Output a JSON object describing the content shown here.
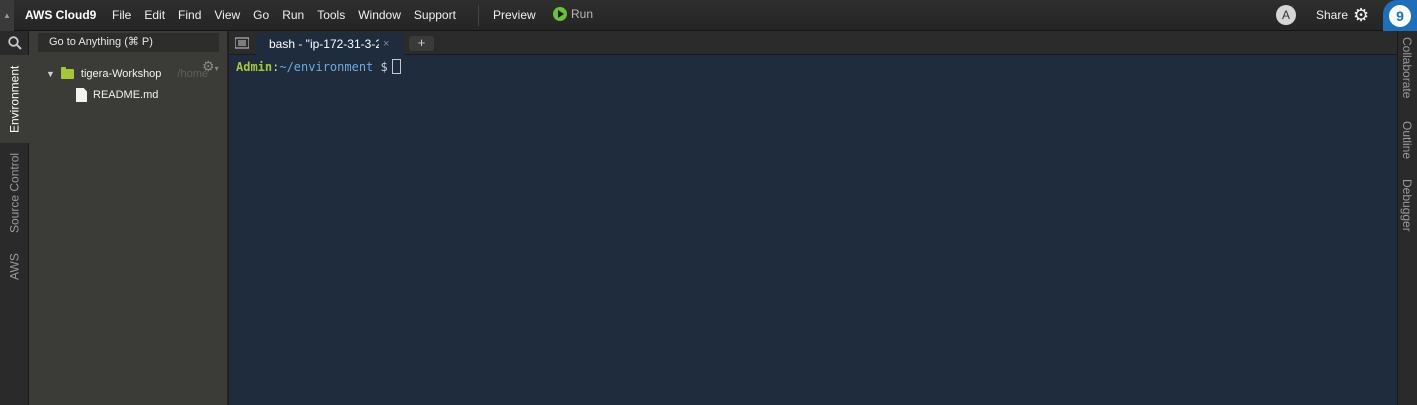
{
  "menubar": {
    "brand": "AWS Cloud9",
    "menus": [
      "File",
      "Edit",
      "Find",
      "View",
      "Go",
      "Run",
      "Tools",
      "Window",
      "Support"
    ],
    "preview": "Preview",
    "run": "Run",
    "avatar_initial": "A",
    "share": "Share",
    "cloud9_badge": "9"
  },
  "left_tabs": [
    "Environment",
    "Source Control",
    "AWS"
  ],
  "sidebar": {
    "goto_placeholder": "Go to Anything (⌘ P)",
    "tree": {
      "root_name": "tigera-Workshop",
      "root_path": "/home",
      "files": [
        "README.md"
      ]
    }
  },
  "editor": {
    "tabs": [
      {
        "label": "bash - \"ip-172-31-3-2",
        "close": "×"
      }
    ],
    "add_tab": "+"
  },
  "terminal": {
    "user": "Admin",
    "colon": ":",
    "dir": "~/environment",
    "dollar": " $"
  },
  "right_tabs": [
    "Collaborate",
    "Outline",
    "Debugger"
  ],
  "colors": {
    "accent_green": "#a4c639",
    "terminal_bg": "#1e2c3d",
    "brand_blue": "#1e6fba"
  }
}
